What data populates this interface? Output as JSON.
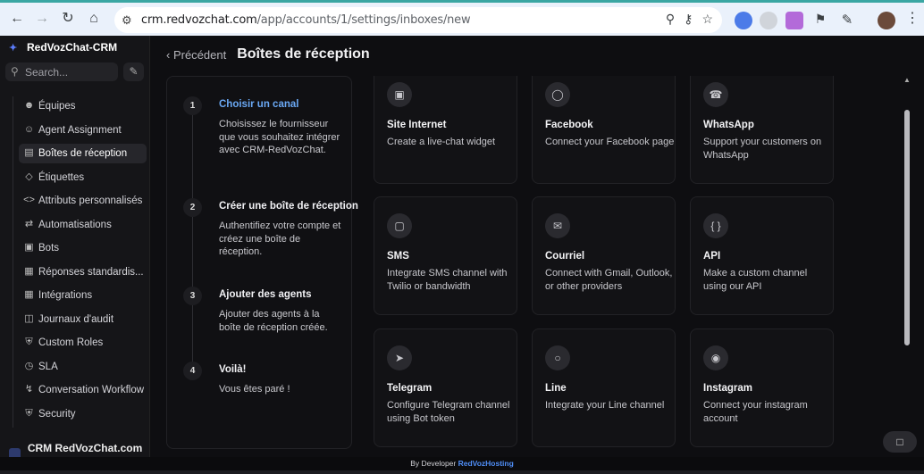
{
  "browser": {
    "url_host": "crm.redvozchat.com",
    "url_path": "/app/accounts/1/settings/inboxes/new"
  },
  "sidebar": {
    "brand": "RedVozChat-CRM",
    "search_placeholder": "Search...",
    "items": [
      {
        "label": "Équipes",
        "icon": "users-icon"
      },
      {
        "label": "Agent Assignment",
        "icon": "user-assign-icon"
      },
      {
        "label": "Boîtes de réception",
        "icon": "inbox-icon"
      },
      {
        "label": "Étiquettes",
        "icon": "tag-icon"
      },
      {
        "label": "Attributs personnalisés",
        "icon": "code-icon"
      },
      {
        "label": "Automatisations",
        "icon": "automation-icon"
      },
      {
        "label": "Bots",
        "icon": "bot-icon"
      },
      {
        "label": "Réponses standardis...",
        "icon": "canned-response-icon"
      },
      {
        "label": "Intégrations",
        "icon": "integrations-icon"
      },
      {
        "label": "Journaux d'audit",
        "icon": "audit-log-icon"
      },
      {
        "label": "Custom Roles",
        "icon": "shield-icon"
      },
      {
        "label": "SLA",
        "icon": "clock-icon"
      },
      {
        "label": "Conversation Workflow",
        "icon": "workflow-icon"
      },
      {
        "label": "Security",
        "icon": "security-icon"
      }
    ],
    "account": "CRM RedVozChat.com s..."
  },
  "header": {
    "back_label": "Précédent",
    "title": "Boîtes de réception"
  },
  "steps": [
    {
      "number": "1",
      "title": "Choisir un canal",
      "description": "Choisissez le fournisseur que vous souhaitez intégrer avec CRM-RedVozChat."
    },
    {
      "number": "2",
      "title": "Créer une boîte de réception",
      "description": "Authentifiez votre compte et créez une boîte de réception."
    },
    {
      "number": "3",
      "title": "Ajouter des agents",
      "description": "Ajouter des agents à la boîte de réception créée."
    },
    {
      "number": "4",
      "title": "Voilà!",
      "description": "Vous êtes paré !"
    }
  ],
  "channels": [
    {
      "title": "Site Internet",
      "description": "Create a live-chat widget",
      "icon": "website-icon"
    },
    {
      "title": "Facebook",
      "description": "Connect your Facebook page",
      "icon": "messenger-icon"
    },
    {
      "title": "WhatsApp",
      "description": "Support your customers on WhatsApp",
      "icon": "whatsapp-icon"
    },
    {
      "title": "SMS",
      "description": "Integrate SMS channel with Twilio or bandwidth",
      "icon": "sms-icon"
    },
    {
      "title": "Courriel",
      "description": "Connect with Gmail, Outlook, or other providers",
      "icon": "email-icon"
    },
    {
      "title": "API",
      "description": "Make a custom channel using our API",
      "icon": "api-icon"
    },
    {
      "title": "Telegram",
      "description": "Configure Telegram channel using Bot token",
      "icon": "telegram-icon"
    },
    {
      "title": "Line",
      "description": "Integrate your Line channel",
      "icon": "line-icon"
    },
    {
      "title": "Instagram",
      "description": "Connect your instagram account",
      "icon": "instagram-icon"
    }
  ],
  "footer": {
    "prefix": "By Developer",
    "brand": "RedVozHosting"
  },
  "colors": {
    "accent": "#6aa8f4",
    "footer_link": "#4f8ef7",
    "background": "#0e0e11"
  }
}
